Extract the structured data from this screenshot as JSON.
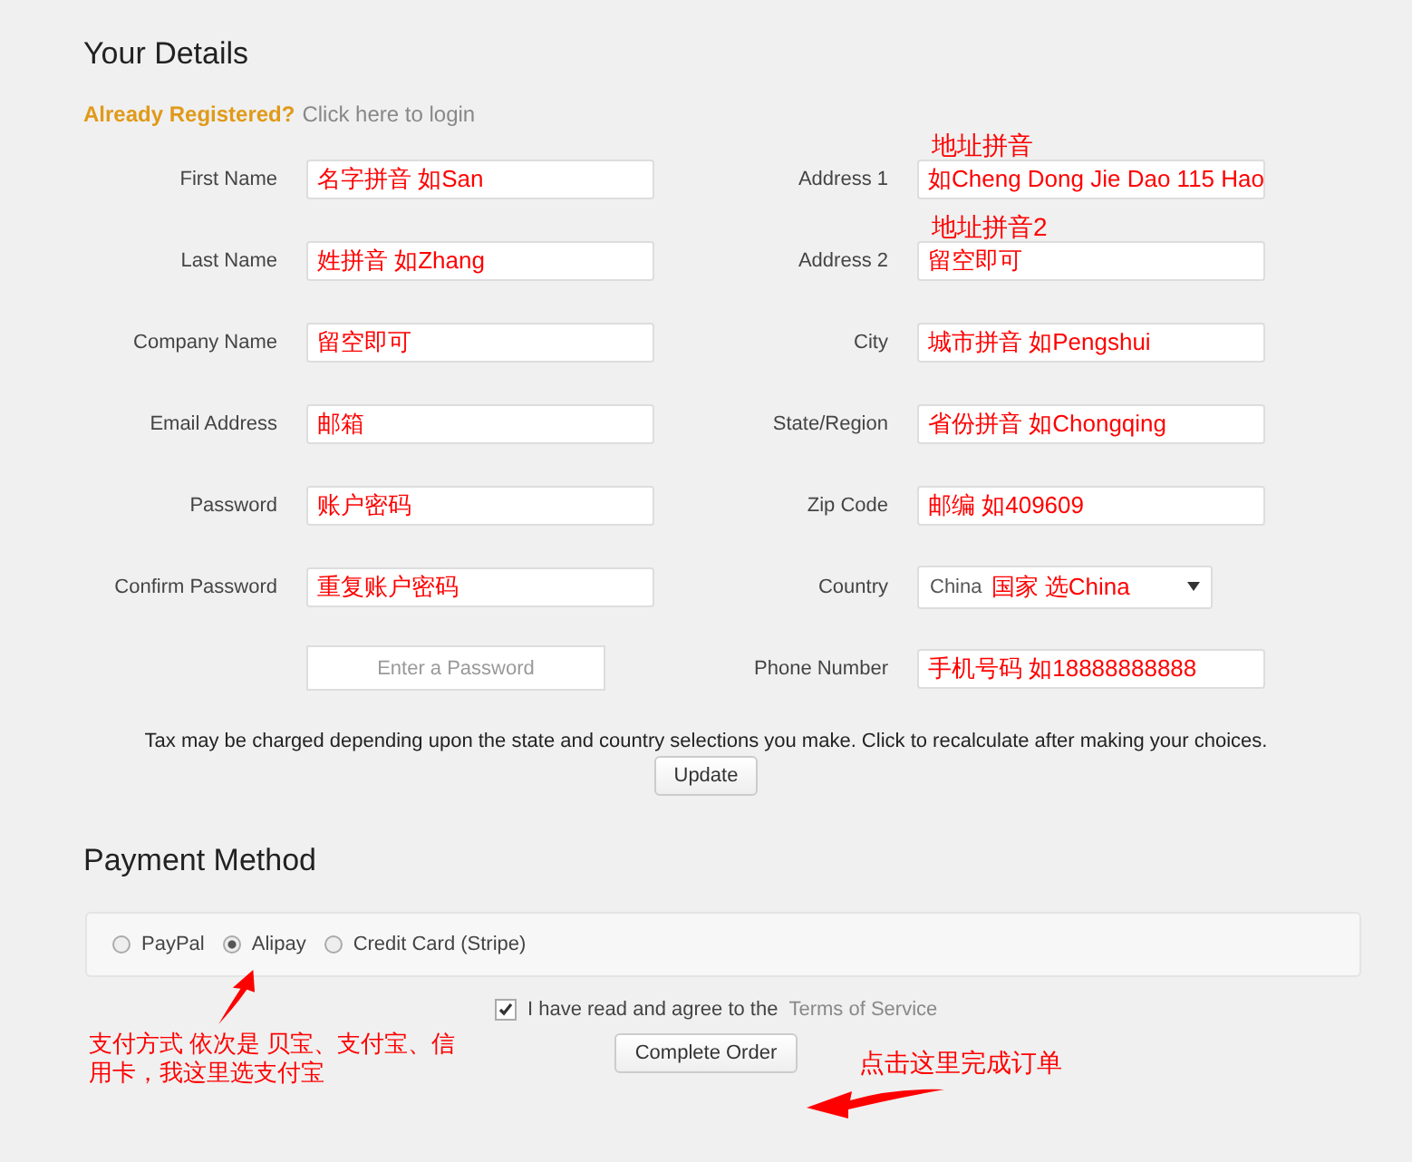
{
  "heading": "Your Details",
  "login": {
    "prompt": "Already Registered?",
    "link": "Click here to login"
  },
  "left_fields": [
    {
      "label": "First Name",
      "value": "名字拼音 如San"
    },
    {
      "label": "Last Name",
      "value": "姓拼音 如Zhang"
    },
    {
      "label": "Company Name",
      "value": "留空即可"
    },
    {
      "label": "Email Address",
      "value": "邮箱"
    },
    {
      "label": "Password",
      "value": "账户密码"
    },
    {
      "label": "Confirm Password",
      "value": "重复账户密码"
    }
  ],
  "password_button": "Enter a Password",
  "right_fields": [
    {
      "kind": "text",
      "label": "Address 1",
      "note": "地址拼音",
      "value": "如Cheng Dong Jie Dao 115 Hao"
    },
    {
      "kind": "text",
      "label": "Address 2",
      "note": "地址拼音2",
      "value": "留空即可"
    },
    {
      "kind": "text",
      "label": "City",
      "value": "城市拼音 如Pengshui"
    },
    {
      "kind": "text",
      "label": "State/Region",
      "value": "省份拼音 如Chongqing"
    },
    {
      "kind": "text",
      "label": "Zip Code",
      "value": "邮编 如409609"
    },
    {
      "kind": "select",
      "label": "Country",
      "value": "China",
      "note": "国家 选China"
    },
    {
      "kind": "text",
      "label": "Phone Number",
      "value": "手机号码 如18888888888"
    }
  ],
  "tax_note": "Tax may be charged depending upon the state and country selections you make. Click to recalculate after making your choices.",
  "update_button": "Update",
  "payment_heading": "Payment Method",
  "payment_options": [
    {
      "label": "PayPal",
      "selected": false
    },
    {
      "label": "Alipay",
      "selected": true
    },
    {
      "label": "Credit Card (Stripe)",
      "selected": false
    }
  ],
  "terms": {
    "checked": true,
    "text": "I have read and agree to the",
    "link": "Terms of Service"
  },
  "complete_button": "Complete Order",
  "annotations": [
    {
      "text": "支付方式 依次是 贝宝、支付宝、信用卡，我这里选支付宝"
    },
    {
      "text": "点击这里完成订单"
    }
  ]
}
